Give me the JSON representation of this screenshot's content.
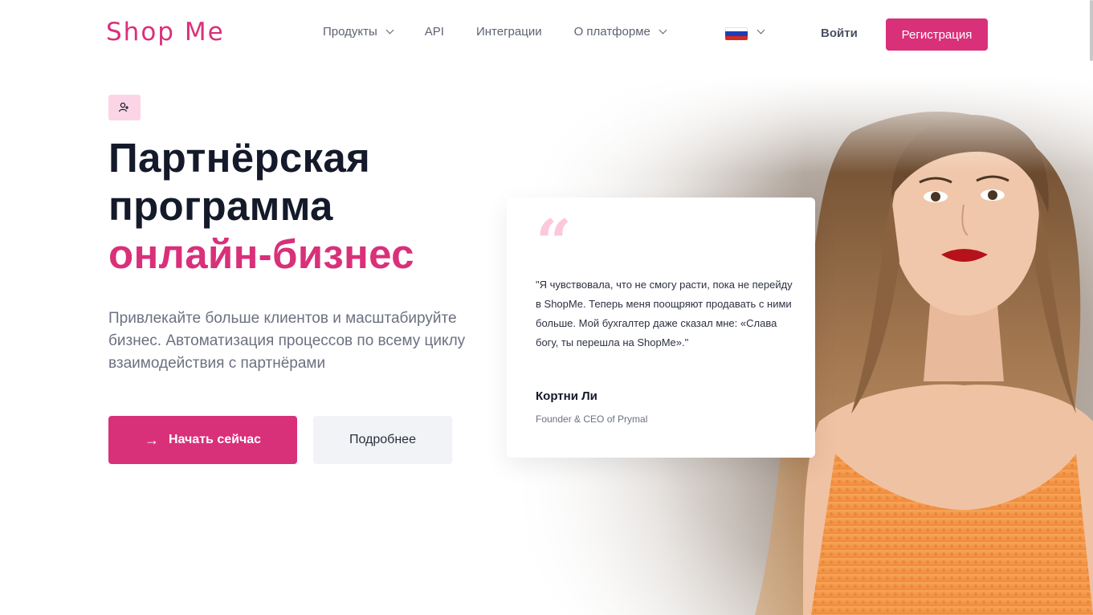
{
  "brand": {
    "logo": "Shop Me",
    "accent_color": "#d9307a",
    "accent_light": "#fbd5e6"
  },
  "nav": {
    "items": [
      {
        "label": "Продукты",
        "has_dropdown": true
      },
      {
        "label": "API",
        "has_dropdown": false
      },
      {
        "label": "Интеграции",
        "has_dropdown": false
      },
      {
        "label": "О платформе",
        "has_dropdown": true
      }
    ],
    "language_icon": "russia-flag-icon",
    "login_label": "Войти",
    "register_label": "Регистрация"
  },
  "hero": {
    "badge_icon": "partners-icon",
    "title_line1": "Партнёрская",
    "title_line2": "программа",
    "title_accent": "онлайн-бизнес",
    "description": "Привлекайте больше клиентов и масштабируйте бизнес. Автоматизация процессов по всему циклу взаимодействия с партнёрами",
    "primary_button": "Начать сейчас",
    "primary_button_icon": "arrow-right-icon",
    "secondary_button": "Подробнее"
  },
  "testimonial": {
    "quote_mark": "“",
    "text": "\"Я чувствовала, что не смогу расти, пока не перейду в ShopMe. Теперь меня поощряют продавать с ними больше. Мой бухгалтер даже сказал мне: «Слава богу, ты перешла на ShopMe».\"",
    "author": "Кортни Ли",
    "role": "Founder & CEO of Prymal"
  }
}
